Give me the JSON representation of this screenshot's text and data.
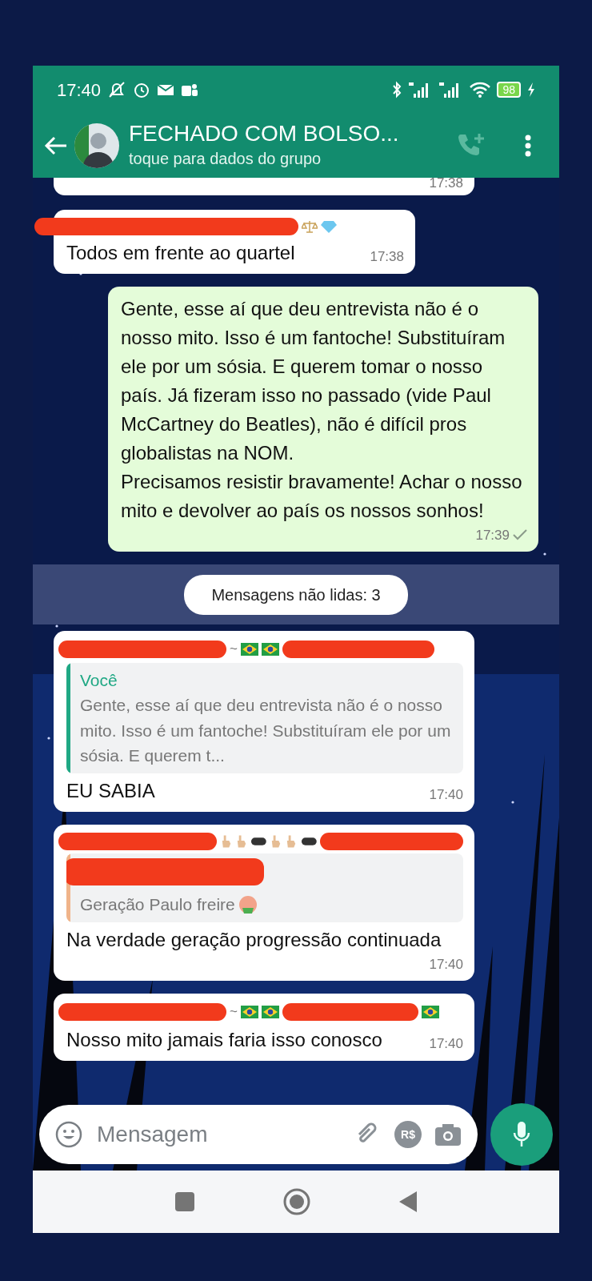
{
  "status_bar": {
    "time": "17:40",
    "battery": "98"
  },
  "header": {
    "title": "FECHADO COM BOLSO...",
    "subtitle": "toque para dados do grupo"
  },
  "messages": [
    {
      "kind": "cut",
      "time": "17:38"
    },
    {
      "kind": "incoming",
      "sender": {
        "kind": "scales-gem"
      },
      "text": "Todos em frente ao quartel",
      "time": "17:38"
    },
    {
      "kind": "outgoing",
      "text": "Gente, esse aí que deu entrevista não é o nosso mito. Isso é um fantoche! Substituíram ele por um sósia. E querem tomar o nosso país. Já fizeram isso no passado (vide Paul McCartney do Beatles), não é difícil pros globalistas na NOM.\nPrecisamos resistir bravamente! Achar o nosso mito e devolver ao país os nossos sonhos!",
      "time": "17:39"
    },
    {
      "kind": "divider",
      "text": "Mensagens não lidas: 3"
    },
    {
      "kind": "incoming",
      "sender": {
        "kind": "flags",
        "prefix": "~"
      },
      "quote": {
        "author": "Você",
        "text": "Gente, esse aí que deu entrevista não é o nosso mito. Isso é um fantoche! Substituíram ele por um sósia. E querem t...",
        "color": "#1fa884"
      },
      "text": "EU SABIA",
      "time": "17:40"
    },
    {
      "kind": "incoming",
      "sender": {
        "kind": "gestures"
      },
      "quote": {
        "text": "Geração Paulo freire",
        "color": "#f0b48a"
      },
      "text": "Na verdade geração progressão continuada",
      "time": "17:40"
    },
    {
      "kind": "incoming",
      "sender": {
        "kind": "flags-more",
        "prefix": "~"
      },
      "text": "Nosso mito jamais faria isso conosco",
      "time": "17:40"
    }
  ],
  "composer": {
    "placeholder": "Mensagem",
    "currency_label": "R$"
  }
}
